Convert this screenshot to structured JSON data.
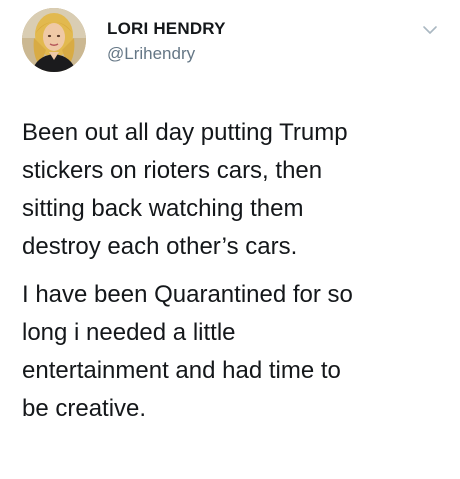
{
  "author": {
    "display_name": "LORI HENDRY",
    "handle": "@Lrihendry",
    "avatar_icon": "profile-photo"
  },
  "menu": {
    "icon": "chevron-down-icon"
  },
  "tweet": {
    "paragraphs": [
      {
        "lines": [
          "Been out all day putting Trump",
          "stickers on rioters cars, then",
          "sitting back watching them",
          "destroy each other’s cars."
        ]
      },
      {
        "lines": [
          "I have been Quarantined for so",
          "long i needed a little",
          "entertainment and had time to",
          "be creative."
        ]
      }
    ]
  },
  "colors": {
    "text": "#14171a",
    "secondary_text": "#657786",
    "caret": "#aab8c2",
    "background": "#ffffff"
  }
}
